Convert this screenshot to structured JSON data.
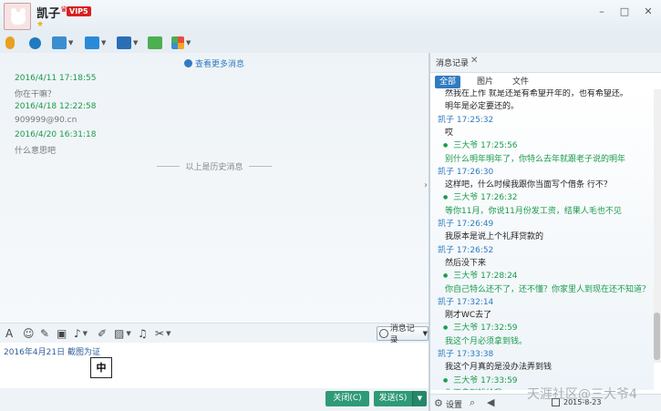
{
  "window": {
    "contact_name": "凯子",
    "vip_badge": "VIP5"
  },
  "chat": {
    "more_link": "查看更多消息",
    "messages": [
      {
        "time": "2016/4/11 17:18:55",
        "text": "你在干嘛？"
      },
      {
        "time": "2016/4/18 12:22:58",
        "text": "909999@90.cn"
      },
      {
        "time": "2016/4/20 16:31:18",
        "text": "什么意思吧"
      }
    ],
    "history_separator": "以上是历史消息"
  },
  "input": {
    "history_button": "消息记录",
    "text": "2016年4月21日 截图为证",
    "ime_indicator": "中",
    "close_button": "关闭(C)",
    "send_button": "发送(S)"
  },
  "history_panel": {
    "tab_label": "消息记录",
    "filters": [
      "全部",
      "图片",
      "文件"
    ],
    "rows": [
      {
        "kind": "text",
        "side": "self",
        "text": "然我在上作 就是还是有希望开年的，也有希望还。"
      },
      {
        "kind": "text",
        "side": "self",
        "text": "明年是必定要还的。"
      },
      {
        "kind": "sender",
        "side": "self",
        "text": "凯子 17:25:32"
      },
      {
        "kind": "text",
        "side": "self",
        "text": "哎"
      },
      {
        "kind": "sender",
        "side": "other",
        "text": "三大爷 17:25:56"
      },
      {
        "kind": "text",
        "side": "other",
        "text": "别什么明年明年了，你特么去年就跟老子说的明年"
      },
      {
        "kind": "sender",
        "side": "self",
        "text": "凯子 17:26:30"
      },
      {
        "kind": "text",
        "side": "self",
        "text": "这样吧，什么时候我跟你当面写个借条 行不？"
      },
      {
        "kind": "sender",
        "side": "other",
        "text": "三大爷 17:26:32"
      },
      {
        "kind": "text",
        "side": "other",
        "text": "等你11月，你说11月份发工资，结果人毛也不见"
      },
      {
        "kind": "sender",
        "side": "self",
        "text": "凯子 17:26:49"
      },
      {
        "kind": "text",
        "side": "self",
        "text": "我原本是说上个礼拜贷款的"
      },
      {
        "kind": "sender",
        "side": "self",
        "text": "凯子 17:26:52"
      },
      {
        "kind": "text",
        "side": "self",
        "text": "然后没下来"
      },
      {
        "kind": "sender",
        "side": "other",
        "text": "三大爷 17:28:24"
      },
      {
        "kind": "text",
        "side": "other",
        "text": "你自己特么还不了，还不懂？你家里人到现在还不知道？"
      },
      {
        "kind": "sender",
        "side": "self",
        "text": "凯子 17:32:14"
      },
      {
        "kind": "text",
        "side": "self",
        "text": "刚才WC去了"
      },
      {
        "kind": "sender",
        "side": "other",
        "text": "三大爷 17:32:59"
      },
      {
        "kind": "text",
        "side": "other",
        "text": "我这个月必须拿到钱。"
      },
      {
        "kind": "sender",
        "side": "self",
        "text": "凯子 17:33:38"
      },
      {
        "kind": "text",
        "side": "self",
        "text": "我这个月真的是没办法弄到钱"
      },
      {
        "kind": "sender",
        "side": "other",
        "text": "三大爷 17:33:59"
      },
      {
        "kind": "text",
        "side": "other",
        "text": "你不拿到钱给我"
      }
    ],
    "footer": {
      "settings_label": "设置",
      "date": "2015-8-23"
    }
  },
  "watermark": "天涯社区@三大爷4"
}
